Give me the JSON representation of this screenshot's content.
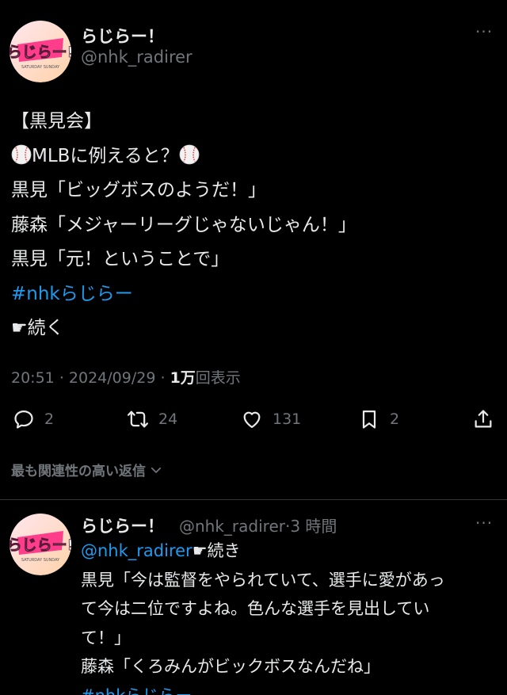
{
  "tweet": {
    "display_name": "らじらー！",
    "handle": "@nhk_radirer",
    "more_icon": "more-dots-icon",
    "lines": {
      "l1": "【黒見会】",
      "l2": "MLBに例えると？",
      "l3": "黒見「ビッグボスのようだ！」",
      "l4": "藤森「メジャーリーグじゃないじゃん！」",
      "l5": "黒見「元！ということで」",
      "l6": "#nhkらじらー",
      "l7": "☛続く"
    },
    "time": "20:51",
    "date": "2024/09/29",
    "views_count": "1万",
    "views_label": "回表示",
    "stats": {
      "replies": "2",
      "retweets": "24",
      "likes": "131",
      "bookmarks": "2"
    }
  },
  "sort_label": "最も関連性の高い返信",
  "reply": {
    "display_name": "らじらー！",
    "handle": "@nhk_radirer",
    "time_ago": "3 時間",
    "mention": "@nhk_radirer",
    "mention_suffix": "☛続き",
    "lines": {
      "l1": "黒見「今は監督をやられていて、選手に愛があっ",
      "l2": "て今は二位ですよね。色んな選手を見出してい",
      "l3": "て！」",
      "l4": "藤森「くろみんがビックボスなんだね」",
      "l5": "#nhkらじらー"
    }
  },
  "avatar_text": {
    "logo": "らじらー!",
    "sub": "SATURDAY SUNDAY"
  }
}
